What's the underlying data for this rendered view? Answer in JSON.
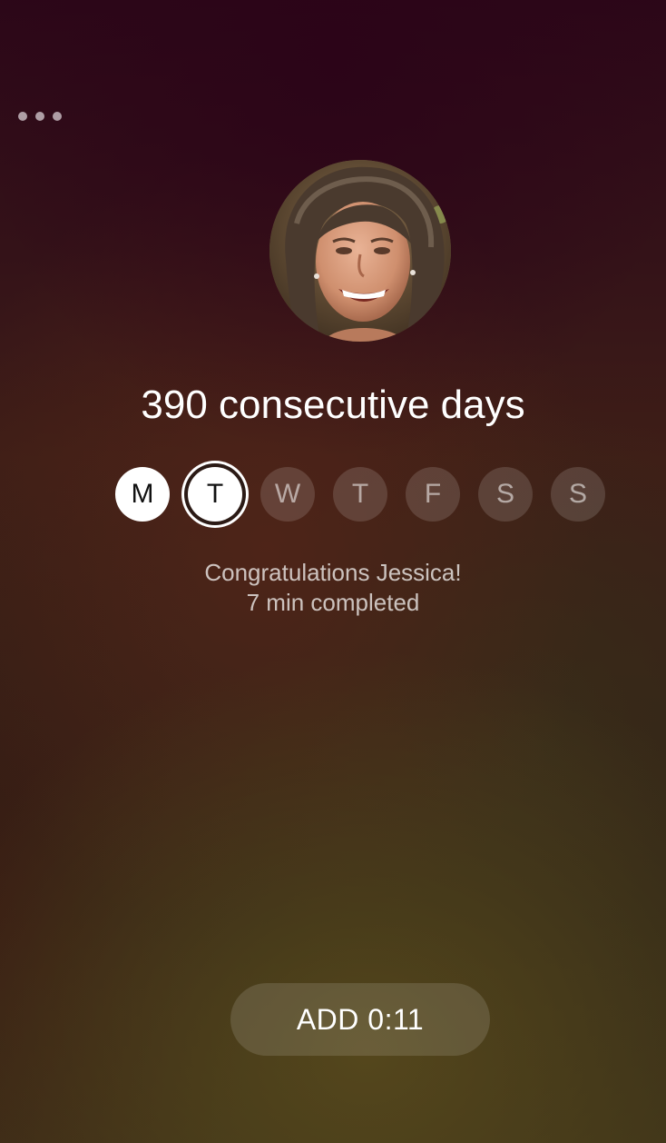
{
  "menu": {
    "icon": "more-horizontal-icon"
  },
  "profile": {
    "avatar_description_icon": "user-photo-avatar"
  },
  "streak": {
    "title": "390 consecutive days"
  },
  "week": {
    "days": [
      {
        "label": "M",
        "state": "completed"
      },
      {
        "label": "T",
        "state": "today-completed"
      },
      {
        "label": "W",
        "state": "upcoming"
      },
      {
        "label": "T",
        "state": "upcoming"
      },
      {
        "label": "F",
        "state": "upcoming"
      },
      {
        "label": "S",
        "state": "upcoming"
      },
      {
        "label": "S",
        "state": "upcoming"
      }
    ]
  },
  "message": {
    "congrats": "Congratulations Jessica!",
    "completed": "7 min completed"
  },
  "action": {
    "add_label": "ADD 0:11"
  },
  "colors": {
    "completed_fill": "#ffffff",
    "upcoming_fill": "rgba(255,255,255,0.14)",
    "text": "#ffffff"
  }
}
